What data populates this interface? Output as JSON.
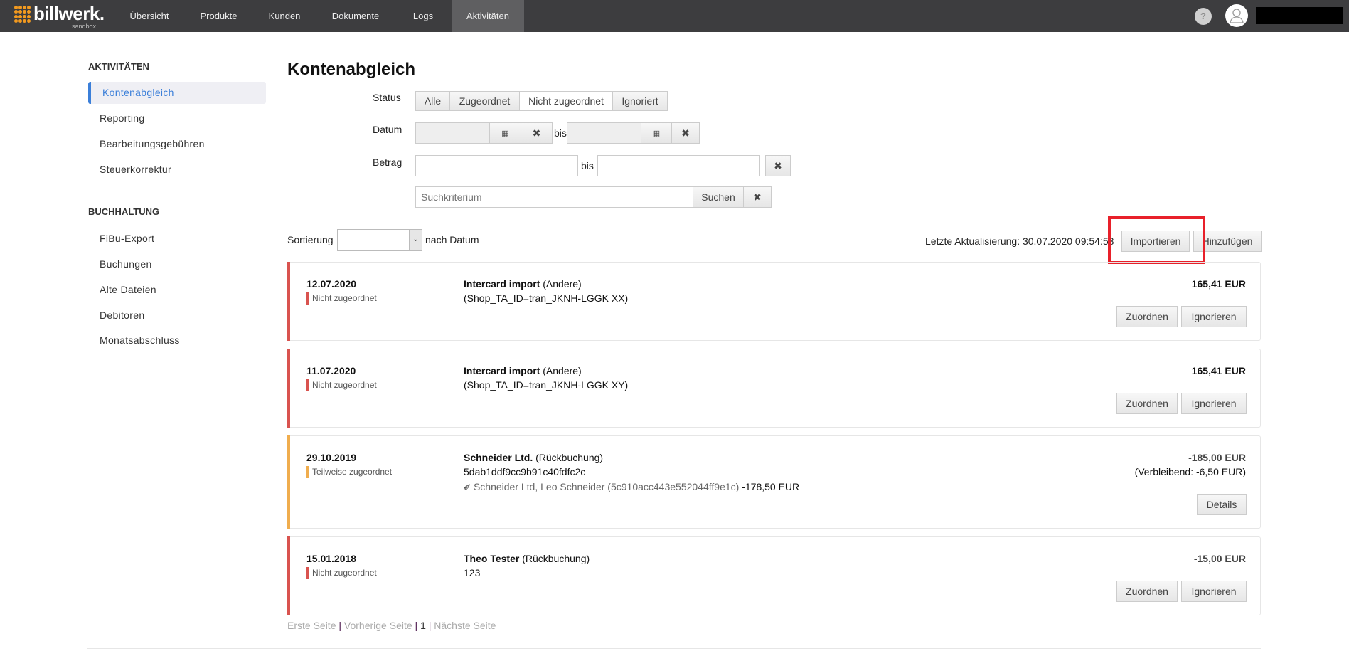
{
  "brand": {
    "name": "billwerk.",
    "sub": "sandbox"
  },
  "nav": {
    "items": [
      "Übersicht",
      "Produkte",
      "Kunden",
      "Dokumente",
      "Logs",
      "Aktivitäten"
    ],
    "active": "Aktivitäten",
    "help": "?"
  },
  "sidebar": {
    "sections": [
      {
        "heading": "AKTIVITÄTEN",
        "items": [
          "Kontenabgleich",
          "Reporting",
          "Bearbeitungsgebühren",
          "Steuerkorrektur"
        ]
      },
      {
        "heading": "BUCHHALTUNG",
        "items": [
          "FiBu-Export",
          "Buchungen",
          "Alte Dateien",
          "Debitoren",
          "Monatsabschluss"
        ]
      }
    ],
    "active": "Kontenabgleich"
  },
  "page": {
    "title": "Kontenabgleich"
  },
  "filters": {
    "status_label": "Status",
    "status_options": [
      "Alle",
      "Zugeordnet",
      "Nicht zugeordnet",
      "Ignoriert"
    ],
    "status_selected": "Nicht zugeordnet",
    "date_label": "Datum",
    "date_from": "",
    "date_to": "",
    "between": "bis",
    "amount_label": "Betrag",
    "amount_from": "",
    "amount_to": "",
    "search_placeholder": "Suchkriterium",
    "search_button": "Suchen"
  },
  "sort": {
    "label": "Sortierung",
    "selected": "",
    "suffix": "nach Datum"
  },
  "toolbar": {
    "last_update": "Letzte Aktualisierung: 30.07.2020 09:54:58",
    "import": "Importieren",
    "add": "Hinzufügen"
  },
  "colors": {
    "unassigned": "#d9534f",
    "partial": "#f0ad4e",
    "active": "#3b7fd9",
    "highlight": "#e8202a"
  },
  "entries": [
    {
      "date": "12.07.2020",
      "status": "Nicht zugeordnet",
      "name": "Intercard import",
      "type": "(Andere)",
      "ref": "(Shop_TA_ID=tran_JKNH-LGGK XX)",
      "amount": "165,41 EUR",
      "actions": [
        "Zuordnen",
        "Ignorieren"
      ]
    },
    {
      "date": "11.07.2020",
      "status": "Nicht zugeordnet",
      "name": "Intercard import",
      "type": "(Andere)",
      "ref": "(Shop_TA_ID=tran_JKNH-LGGK XY)",
      "amount": "165,41 EUR",
      "actions": [
        "Zuordnen",
        "Ignorieren"
      ]
    },
    {
      "date": "29.10.2019",
      "status": "Teilweise zugeordnet",
      "name": "Schneider Ltd.",
      "type": "(Rückbuchung)",
      "ref": "5dab1ddf9cc9b91c40fdfc2c",
      "link": "Schneider Ltd, Leo Schneider (5c910acc443e552044ff9e1c)",
      "link_amount": "-178,50 EUR",
      "amount": "-185,00 EUR",
      "remaining": "(Verbleibend: -6,50 EUR)",
      "actions": [
        "Details"
      ]
    },
    {
      "date": "15.01.2018",
      "status": "Nicht zugeordnet",
      "name": "Theo Tester",
      "type": "(Rückbuchung)",
      "ref": "123",
      "amount": "-15,00 EUR",
      "actions": [
        "Zuordnen",
        "Ignorieren"
      ]
    }
  ],
  "pagination": {
    "first": "Erste Seite",
    "prev": "Vorherige Seite",
    "current": "1",
    "next": "Nächste Seite",
    "sep": "|"
  }
}
